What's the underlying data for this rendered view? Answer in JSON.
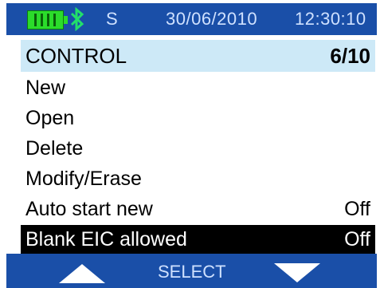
{
  "status": {
    "s_label": "S",
    "date": "30/06/2010",
    "time": "12:30:10",
    "battery_icon": "battery-full-icon",
    "bluetooth_icon": "bluetooth-icon"
  },
  "header": {
    "title": "CONTROL",
    "page_count": "6/10"
  },
  "menu": {
    "items": [
      {
        "label": "New",
        "value": ""
      },
      {
        "label": "Open",
        "value": ""
      },
      {
        "label": "Delete",
        "value": ""
      },
      {
        "label": "Modify/Erase",
        "value": ""
      },
      {
        "label": "Auto start new",
        "value": "Off"
      },
      {
        "label": "Blank EIC allowed",
        "value": "Off"
      }
    ],
    "selected_index": 5
  },
  "softkeys": {
    "select_label": "SELECT",
    "up_icon": "up-arrow-icon",
    "down_icon": "down-arrow-icon"
  },
  "colors": {
    "bar_blue": "#1a4fa8",
    "title_highlight": "#cde9f7",
    "battery_green": "#2bdc2b",
    "bluetooth_green": "#22e06a",
    "selected_bg": "#000000"
  }
}
